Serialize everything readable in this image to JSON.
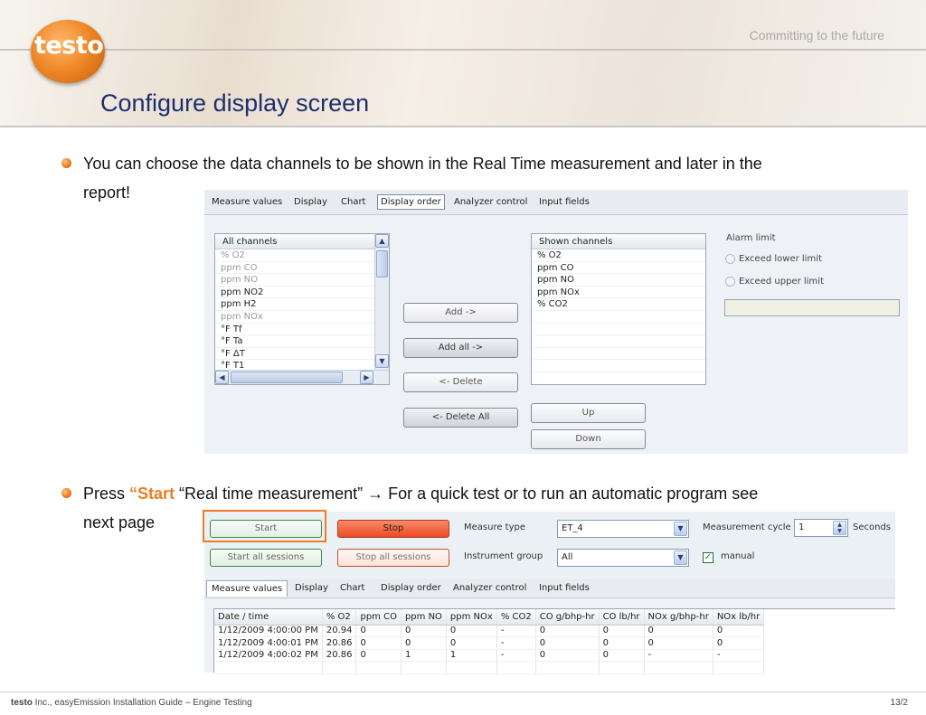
{
  "header": {
    "logo_text": "testo",
    "tagline": "Committing to the future",
    "title": "Configure display screen"
  },
  "bullets": [
    {
      "text1": "You can choose the data channels to be shown in the Real Time measurement and later in the",
      "text2": "report!"
    },
    {
      "prefix": "Press ",
      "highlight": "“Start",
      "rest": " “Real time measurement” → For a quick test or to run an automatic program see",
      "text2": "next page"
    }
  ],
  "panel1": {
    "tabs": [
      "Measure values",
      "Display",
      "Chart",
      "Display order",
      "Analyzer control",
      "Input fields"
    ],
    "active_tab": "Display order",
    "all_channels": {
      "header": "All channels",
      "items": [
        {
          "label": "% O2",
          "dim": true
        },
        {
          "label": "ppm CO",
          "dim": true
        },
        {
          "label": "ppm NO",
          "dim": true
        },
        {
          "label": "ppm NO2",
          "dim": false
        },
        {
          "label": "ppm H2",
          "dim": false
        },
        {
          "label": "ppm NOx",
          "dim": true
        },
        {
          "label": "°F Tf",
          "dim": false
        },
        {
          "label": "°F Ta",
          "dim": false
        },
        {
          "label": "°F ΔT",
          "dim": false
        },
        {
          "label": "°F T1",
          "dim": false
        }
      ]
    },
    "buttons": {
      "add": "Add ->",
      "add_all": "Add all ->",
      "delete": "<- Delete",
      "delete_all": "<- Delete All",
      "up": "Up",
      "down": "Down"
    },
    "shown_channels": {
      "header": "Shown channels",
      "items": [
        "% O2",
        "ppm CO",
        "ppm NO",
        "ppm NOx",
        "% CO2"
      ]
    },
    "alarm": {
      "title": "Alarm limit",
      "lower": "Exceed lower limit",
      "upper": "Exceed upper limit",
      "value": ""
    }
  },
  "panel2": {
    "start": "Start",
    "stop": "Stop",
    "start_all": "Start all sessions",
    "stop_all": "Stop all sessions",
    "measure_type_label": "Measure type",
    "measure_type_value": "ET_4",
    "instrument_group_label": "Instrument group",
    "instrument_group_value": "All",
    "cycle_label": "Measurement cycle",
    "cycle_value": "1",
    "cycle_unit": "Seconds",
    "manual_label": "manual",
    "manual_checked": true,
    "tabs": [
      "Measure values",
      "Display",
      "Chart",
      "Display order",
      "Analyzer control",
      "Input fields"
    ],
    "active_tab": "Measure values",
    "columns": [
      "Date / time",
      "% O2",
      "ppm CO",
      "ppm NO",
      "ppm NOx",
      "% CO2",
      "CO g/bhp-hr",
      "CO lb/hr",
      "NOx g/bhp-hr",
      "NOx lb/hr"
    ],
    "rows": [
      [
        "1/12/2009 4:00:00 PM",
        "20.94",
        "0",
        "0",
        "0",
        "-",
        "0",
        "0",
        "0",
        "0"
      ],
      [
        "1/12/2009 4:00:01 PM",
        "20.86",
        "0",
        "0",
        "0",
        "-",
        "0",
        "0",
        "0",
        "0"
      ],
      [
        "1/12/2009 4:00:02 PM",
        "20.86",
        "0",
        "1",
        "1",
        "-",
        "0",
        "0",
        "-",
        "-"
      ]
    ]
  },
  "footer": {
    "brand": "testo",
    "text": " Inc., easyEmission Installation Guide – Engine Testing",
    "page": "13/2"
  },
  "colors": {
    "accent": "#ee7d23",
    "title": "#1c2f6e",
    "stop": "#f0502b"
  }
}
